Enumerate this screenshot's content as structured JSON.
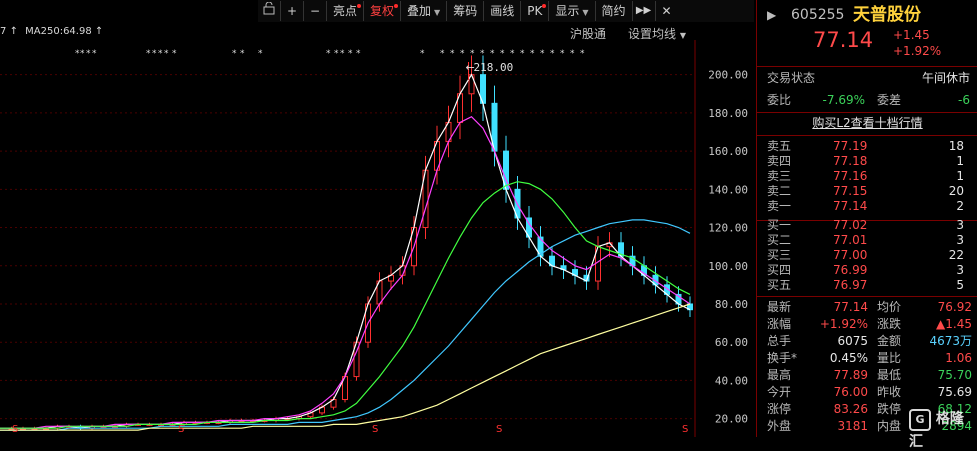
{
  "toolbar": {
    "lock_icon": "lock-icon",
    "zoom_in_label": "+",
    "zoom_out_label": "−",
    "items": [
      {
        "label": "亮点",
        "dot": true
      },
      {
        "label": "复权",
        "dot": true,
        "active": true
      },
      {
        "label": "叠加",
        "arrow": "▼"
      },
      {
        "label": "筹码"
      },
      {
        "label": "画线"
      },
      {
        "label": "PK",
        "dot": true
      },
      {
        "label": "显示",
        "arrow": "▼"
      },
      {
        "label": "简约"
      }
    ],
    "more_label": "▶▶",
    "close_label": "✕"
  },
  "chart_header": {
    "ma_prefix": "7",
    "ma_label": "MA250:64.98",
    "arrow": "↑",
    "hgt_label": "沪股通",
    "ma_settings_label": "设置均线",
    "ma_settings_arrow": "▼"
  },
  "stock": {
    "code": "605255",
    "name": "天普股份",
    "price": "77.14",
    "change": "+1.45",
    "change_pct": "+1.92%",
    "status_label": "交易状态",
    "status_value": "午间休市",
    "weibi_label": "委比",
    "weibi_value": "-7.69%",
    "weicha_label": "委差",
    "weicha_value": "-6",
    "l2_link": "购买L2查看十档行情"
  },
  "asks": [
    {
      "label": "卖五",
      "price": "77.19",
      "vol": "18"
    },
    {
      "label": "卖四",
      "price": "77.18",
      "vol": "1"
    },
    {
      "label": "卖三",
      "price": "77.16",
      "vol": "1"
    },
    {
      "label": "卖二",
      "price": "77.15",
      "vol": "20"
    },
    {
      "label": "卖一",
      "price": "77.14",
      "vol": "2"
    }
  ],
  "bids": [
    {
      "label": "买一",
      "price": "77.02",
      "vol": "3"
    },
    {
      "label": "买二",
      "price": "77.01",
      "vol": "3"
    },
    {
      "label": "买三",
      "price": "77.00",
      "vol": "22"
    },
    {
      "label": "买四",
      "price": "76.99",
      "vol": "3"
    },
    {
      "label": "买五",
      "price": "76.97",
      "vol": "5"
    }
  ],
  "quote": [
    {
      "l1": "最新",
      "v1": "77.14",
      "c1": "red",
      "l2": "均价",
      "v2": "76.92",
      "c2": "red"
    },
    {
      "l1": "涨幅",
      "v1": "+1.92%",
      "c1": "red",
      "l2": "涨跌",
      "v2": "▲1.45",
      "c2": "red"
    },
    {
      "l1": "总手",
      "v1": "6075",
      "c1": "wht",
      "l2": "金额",
      "v2": "4673万",
      "c2": "cyan"
    },
    {
      "l1": "换手*",
      "v1": "0.45%",
      "c1": "wht",
      "l2": "量比",
      "v2": "1.06",
      "c2": "red"
    },
    {
      "l1": "最高",
      "v1": "77.89",
      "c1": "red",
      "l2": "最低",
      "v2": "75.70",
      "c2": "grn"
    },
    {
      "l1": "今开",
      "v1": "76.00",
      "c1": "red",
      "l2": "昨收",
      "v2": "75.69",
      "c2": "wht"
    },
    {
      "l1": "涨停",
      "v1": "83.26",
      "c1": "red",
      "l2": "跌停",
      "v2": "68.12",
      "c2": "grn"
    },
    {
      "l1": "外盘",
      "v1": "3181",
      "c1": "red",
      "l2": "内盘",
      "v2": "2894",
      "c2": "grn"
    }
  ],
  "chart_data": {
    "type": "line",
    "y_ticks": [
      "200.00",
      "180.00",
      "160.00",
      "140.00",
      "120.00",
      "100.00",
      "80.00",
      "60.00",
      "40.00",
      "20.00"
    ],
    "ylim": [
      13,
      215
    ],
    "peak_label": "218.00",
    "colors": {
      "up": "#ff3030",
      "down": "#40e0ff",
      "ma5": "#ffffff",
      "ma10": "#ffd000",
      "ma20": "#ff40ff",
      "ma60": "#40ff40",
      "ma120": "#40c8ff",
      "ma250": "#ffffa0"
    },
    "close_series": [
      15,
      15,
      15,
      15,
      15,
      16,
      16,
      15,
      16,
      16,
      16,
      17,
      17,
      17,
      17,
      17,
      18,
      18,
      18,
      18,
      19,
      19,
      19,
      19,
      20,
      20,
      21,
      23,
      26,
      30,
      42,
      60,
      80,
      92,
      95,
      100,
      120,
      150,
      165,
      175,
      190,
      200,
      185,
      160,
      140,
      125,
      115,
      105,
      100,
      98,
      95,
      92,
      110,
      112,
      105,
      100,
      95,
      90,
      85,
      80,
      77
    ],
    "ma_series": {
      "ma20": [
        15,
        15,
        15,
        15,
        16,
        16,
        16,
        16,
        16,
        16,
        17,
        17,
        17,
        17,
        17,
        18,
        18,
        18,
        18,
        19,
        19,
        19,
        19,
        20,
        20,
        21,
        22,
        24,
        28,
        33,
        42,
        55,
        70,
        80,
        88,
        95,
        110,
        130,
        150,
        165,
        175,
        178,
        172,
        160,
        145,
        132,
        122,
        114,
        108,
        104,
        100,
        98,
        102,
        106,
        104,
        100,
        96,
        92,
        88,
        84,
        80
      ],
      "ma60": [
        15,
        15,
        15,
        15,
        15,
        15,
        16,
        16,
        16,
        16,
        16,
        16,
        17,
        17,
        17,
        17,
        17,
        17,
        18,
        18,
        18,
        18,
        18,
        19,
        19,
        19,
        20,
        20,
        21,
        22,
        24,
        28,
        35,
        42,
        50,
        58,
        68,
        80,
        92,
        104,
        115,
        125,
        133,
        138,
        142,
        144,
        143,
        140,
        135,
        128,
        120,
        113,
        110,
        108,
        106,
        104,
        100,
        96,
        92,
        88,
        85
      ],
      "ma120": [
        14,
        14,
        14,
        14,
        14,
        14,
        15,
        15,
        15,
        15,
        15,
        15,
        15,
        15,
        16,
        16,
        16,
        16,
        16,
        16,
        17,
        17,
        17,
        17,
        17,
        17,
        18,
        18,
        18,
        19,
        20,
        21,
        23,
        26,
        30,
        35,
        40,
        46,
        52,
        58,
        65,
        72,
        79,
        86,
        92,
        97,
        102,
        106,
        110,
        113,
        116,
        118,
        120,
        122,
        123,
        124,
        124,
        123,
        122,
        120,
        117
      ],
      "ma250": [
        14,
        14,
        14,
        14,
        14,
        14,
        14,
        14,
        14,
        14,
        14,
        14,
        14,
        15,
        15,
        15,
        15,
        15,
        15,
        15,
        15,
        15,
        16,
        16,
        16,
        16,
        16,
        16,
        16,
        17,
        17,
        17,
        18,
        19,
        20,
        21,
        23,
        25,
        27,
        30,
        33,
        36,
        39,
        42,
        45,
        48,
        51,
        54,
        56,
        58,
        60,
        62,
        64,
        66,
        68,
        70,
        72,
        74,
        76,
        78,
        80
      ]
    }
  }
}
